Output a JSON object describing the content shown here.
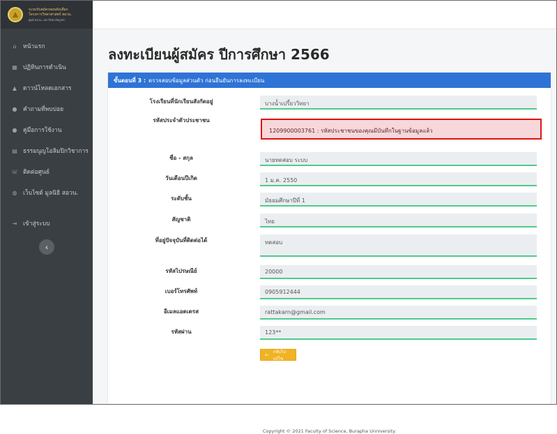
{
  "brand": {
    "line1": "ระบบรับสมัครสอบคัดเลือก",
    "line2": "โครงการวิทยาศาสตร์ สอวน.",
    "line3": "ศูนย์ สอวน. มหาวิทยาลัยบูรพา"
  },
  "sidebar": {
    "items": [
      {
        "label": "หน้าแรก",
        "icon": "home-icon",
        "glyph": "⌂"
      },
      {
        "label": "ปฏิทินการดำเนิน",
        "icon": "calendar-icon",
        "glyph": "▦"
      },
      {
        "label": "ดาวน์โหลดเอกสาร",
        "icon": "download-icon",
        "glyph": "▲"
      },
      {
        "label": "คำถามที่พบบ่อย",
        "icon": "question-icon",
        "glyph": "●"
      },
      {
        "label": "คู่มือการใช้งาน",
        "icon": "manual-icon",
        "glyph": "●"
      },
      {
        "label": "ธรรมนูญโอลิมปิกวิชาการ",
        "icon": "document-icon",
        "glyph": "▤"
      },
      {
        "label": "ติดต่อศูนย์",
        "icon": "contact-icon",
        "glyph": "☏"
      },
      {
        "label": "เว็บไซต์ มูลนิธิ สอวน.",
        "icon": "globe-icon",
        "glyph": "◍"
      }
    ],
    "login": {
      "label": "เข้าสู่ระบบ",
      "glyph": "⇥"
    },
    "collapse_glyph": "‹"
  },
  "page": {
    "title": "ลงทะเบียนผู้สมัคร ปีการศึกษา 2566"
  },
  "card": {
    "step": "ขั้นตอนที่ 3 :",
    "heading": "ตรวจสอบข้อมูลส่วนตัว ก่อนยืนยันการลงทะเบียน"
  },
  "form": {
    "school": {
      "label": "โรงเรียนที่นักเรียนสังกัดอยู่",
      "value": "บางน้ำเปรี้ยววิทยา"
    },
    "citizen_id": {
      "label": "รหัสประจำตัวประชาชน",
      "value": "1209900003761 : รหัสประชาชนของคุณมีบันทึกในฐานข้อมูลแล้ว"
    },
    "fullname": {
      "label": "ชื่อ - สกุล",
      "value": "นายทดสอบ ระบบ"
    },
    "birthdate": {
      "label": "วันเดือนปีเกิด",
      "value": "1 ม.ค. 2550"
    },
    "grade": {
      "label": "ระดับชั้น",
      "value": "มัธยมศึกษาปีที่ 1"
    },
    "nationality": {
      "label": "สัญชาติ",
      "value": "ไทย"
    },
    "address": {
      "label": "ที่อยู่ปัจจุบันที่ติดต่อได้",
      "value": "ทดสอบ"
    },
    "postcode": {
      "label": "รหัสไปรษณีย์",
      "value": "20000"
    },
    "phone": {
      "label": "เบอร์โทรศัพท์",
      "value": "0905912444"
    },
    "email": {
      "label": "อีเมลแอดเดรส",
      "value": "rattakarn@gmail.com"
    },
    "password": {
      "label": "รหัสผ่าน",
      "value": "123**"
    }
  },
  "buttons": {
    "back_label": "กลับไปแก้ไข",
    "back_glyph": "←"
  },
  "footer": {
    "text": "Copyright © 2021 Faculty of Science, Burapha Unniversity."
  },
  "colors": {
    "sidebar_bg": "#3a3f44",
    "card_header": "#2e73d6",
    "field_underline": "#4ecb8c",
    "error_border": "#e01212",
    "back_button": "#f0b323"
  }
}
